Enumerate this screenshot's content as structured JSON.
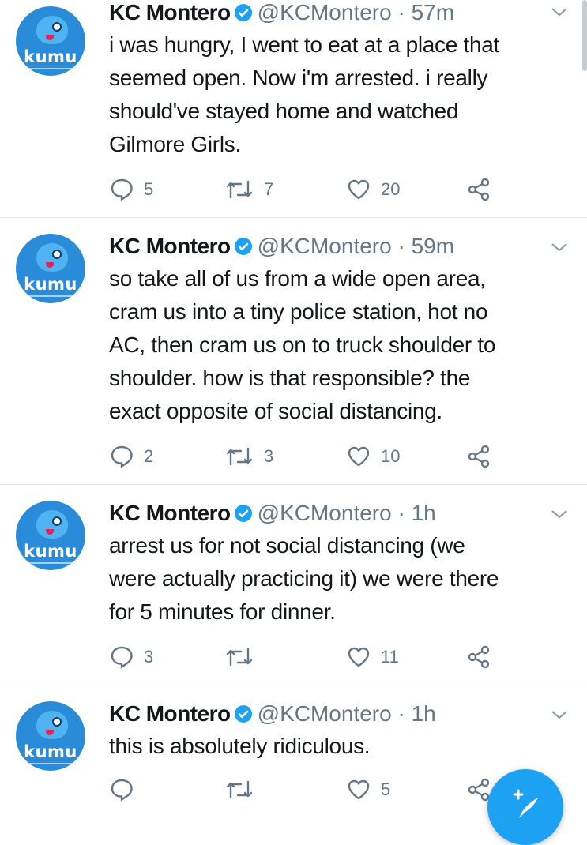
{
  "colors": {
    "accent": "#1da1f2",
    "text": "#14171a",
    "muted": "#657786"
  },
  "tweets": [
    {
      "name": "KC Montero",
      "handle": "@KCMontero",
      "dot": "·",
      "time": "57m",
      "avatar_label": "kumu",
      "lines": [
        "i was hungry, I went to eat at a place that",
        "seemed open. Now i'm arrested. i really",
        "should've stayed home and watched",
        "Gilmore Girls."
      ],
      "replies": "5",
      "retweets": "7",
      "likes": "20"
    },
    {
      "name": "KC Montero",
      "handle": "@KCMontero",
      "dot": "·",
      "time": "59m",
      "avatar_label": "kumu",
      "lines": [
        "so take all of us from a wide open area,",
        "cram us into a tiny police station, hot no",
        "AC, then cram us on to truck shoulder to",
        "shoulder. how is that responsible? the",
        "exact opposite of social distancing."
      ],
      "replies": "2",
      "retweets": "3",
      "likes": "10"
    },
    {
      "name": "KC Montero",
      "handle": "@KCMontero",
      "dot": "·",
      "time": "1h",
      "avatar_label": "kumu",
      "lines": [
        "arrest us for not social distancing (we",
        "were actually practicing it) we were there",
        "for 5 minutes for dinner."
      ],
      "replies": "3",
      "retweets": "",
      "likes": "11"
    },
    {
      "name": "KC Montero",
      "handle": "@KCMontero",
      "dot": "·",
      "time": "1h",
      "avatar_label": "kumu",
      "lines": [
        "this is absolutely ridiculous."
      ],
      "replies": "",
      "retweets": "",
      "likes": "5"
    }
  ]
}
